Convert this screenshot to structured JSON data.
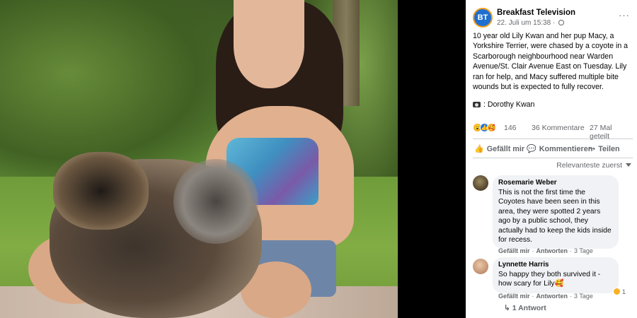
{
  "post": {
    "page_name": "Breakfast Television",
    "page_avatar_text": "BT",
    "timestamp": "22. Juli um 15:38 ·",
    "more_icon": "···",
    "text": "10 year old Lily Kwan and her pup Macy, a Yorkshire Terrier, were chased by a coyote in a Scarborough neighbourhood near Warden Avenue/St. Clair Avenue East on Tuesday. Lily ran for help, and Macy suffered multiple bite wounds but is expected to fully recover.",
    "credit": ": Dorothy Kwan"
  },
  "stats": {
    "reaction_count": "146",
    "comments": "36 Kommentare",
    "shares": "27 Mal geteilt"
  },
  "actions": {
    "like": "Gefällt mir",
    "comment": "Kommentieren",
    "share": "Teilen"
  },
  "sort_label": "Relevanteste zuerst",
  "comments": [
    {
      "name": "Rosemarie Weber",
      "text": "This is not the first time the Coyotes have been seen in this area, they were spotted 2 years ago by a public school, they actually had to keep the kids inside for recess.",
      "like": "Gefällt mir",
      "reply": "Antworten",
      "age": "3 Tage"
    },
    {
      "name": "Lynnette Harris",
      "text": "So happy they both survived it - how scary for Lily🥰",
      "like": "Gefällt mir",
      "reply": "Antworten",
      "age": "3 Tage",
      "reaction_count": "1",
      "replies": "↳ 1 Antwort"
    }
  ],
  "colors": {
    "link_blue": "#1877f2",
    "secondary_text": "#65676b",
    "bubble_bg": "#f0f2f5"
  }
}
